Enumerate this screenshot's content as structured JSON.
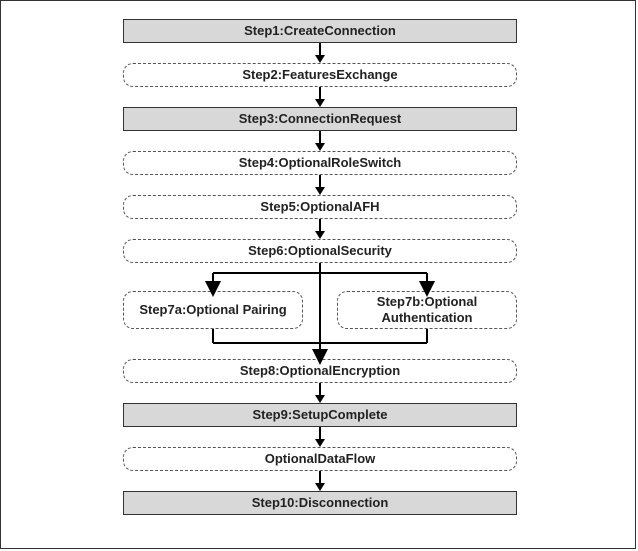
{
  "steps": {
    "s1": "Step1:CreateConnection",
    "s2": "Step2:FeaturesExchange",
    "s3": "Step3:ConnectionRequest",
    "s4": "Step4:OptionalRoleSwitch",
    "s5": "Step5:OptionalAFH",
    "s6": "Step6:OptionalSecurity",
    "s7a": "Step7a:Optional Pairing",
    "s7b": "Step7b:Optional Authentication",
    "s8": "Step8:OptionalEncryption",
    "s9": "Step9:SetupComplete",
    "odf": "OptionalDataFlow",
    "s10": "Step10:Disconnection"
  }
}
